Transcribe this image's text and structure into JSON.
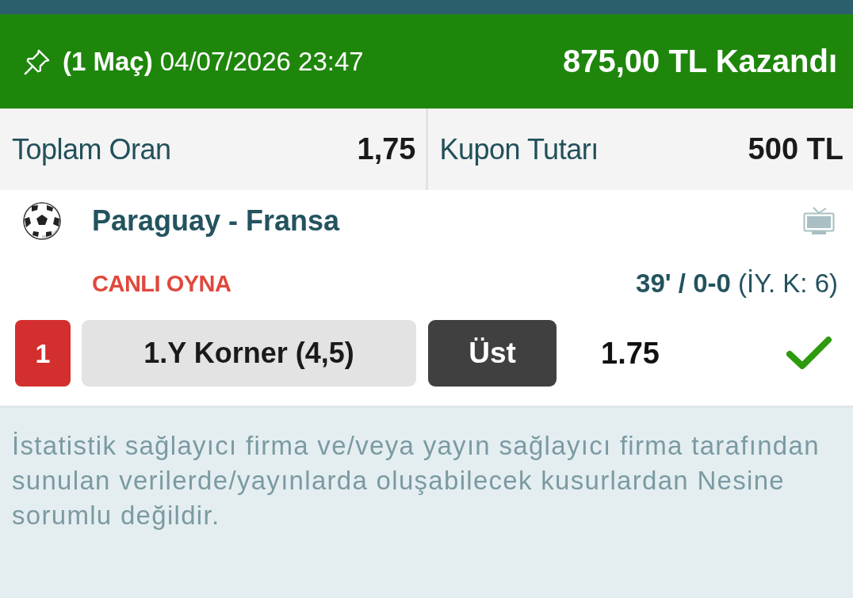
{
  "header": {
    "match_count": "(1 Maç)",
    "date": "04/07/2026 23:47",
    "result": "875,00 TL Kazandı"
  },
  "summary": [
    {
      "label": "Toplam Oran",
      "value": "1,75"
    },
    {
      "label": "Kupon Tutarı",
      "value": "500 TL"
    }
  ],
  "match": {
    "teams": "Paraguay - Fransa",
    "live_label": "CANLI OYNA",
    "live_status": "**39' / 0-0** (İY. K: 6)",
    "selections": [
      {
        "number": "1",
        "market": "1.Y Korner (4,5)",
        "pick": "Üst",
        "odds": "1.75",
        "won": true
      }
    ]
  },
  "disclaimer": "İstatistik sağlayıcı firma ve/veya yayın sağlayıcı firma tarafından sunulan verilerde/yayınlarda oluşabilecek kusurlardan Nesine sorumlu değildir."
}
